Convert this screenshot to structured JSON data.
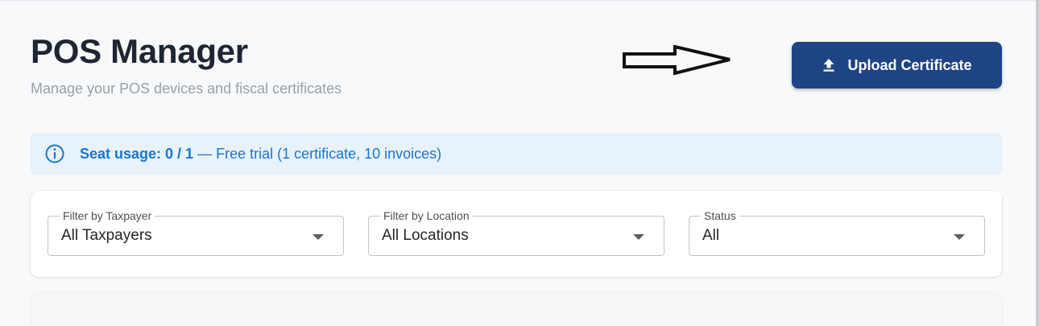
{
  "header": {
    "title": "POS Manager",
    "subtitle": "Manage your POS devices and fiscal certificates"
  },
  "actions": {
    "upload_label": "Upload Certificate"
  },
  "banner": {
    "seat_label": "Seat usage: 0 / 1",
    "plan_text": " — Free trial (1 certificate, 10 invoices)"
  },
  "filters": [
    {
      "label": "Filter by Taxpayer",
      "value": "All Taxpayers"
    },
    {
      "label": "Filter by Location",
      "value": "All Locations"
    },
    {
      "label": "Status",
      "value": "All"
    }
  ],
  "icons": {
    "upload": "upload-icon",
    "info": "info-icon",
    "caret": "chevron-down-icon",
    "arrow": "arrow-right-icon"
  },
  "colors": {
    "primary": "#1f4485",
    "info": "#1976d2",
    "info_bg": "#e7f2fb",
    "title": "#1e2533",
    "subtitle": "#9aa0a8"
  }
}
